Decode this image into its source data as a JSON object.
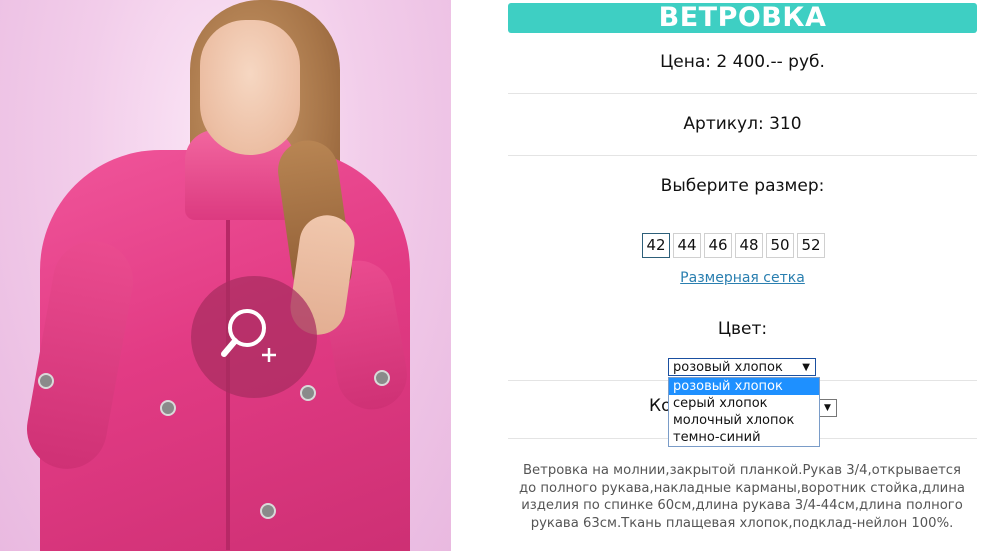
{
  "product": {
    "title": "ВЕТРОВКА",
    "price_line": "Цена: 2 400.-- руб.",
    "article_line": "Артикул: 310",
    "choose_size_label": "Выберите размер:",
    "sizes": [
      "42",
      "44",
      "46",
      "48",
      "50",
      "52"
    ],
    "selected_size": "42",
    "size_chart_link": "Размерная сетка",
    "color_label": "Цвет:",
    "color_select": {
      "value": "розовый хлопок",
      "options": [
        "розовый хлопок",
        "серый хлопок",
        "молочный хлопок",
        "темно-синий"
      ]
    },
    "quantity_label": "Ко",
    "description": "Ветровка на молнии,закрытой планкой.Рукав 3/4,открывается до полного рукава,накладные карманы,воротник стойка,длина изделия по спинке 60см,длина рукава 3/4-44см,длина полного рукава 63см.Ткань плащевая хлопок,подклад-нейлон 100%."
  },
  "colors": {
    "title_bar": "#3ecfc3",
    "link": "#2a7fb0",
    "dropdown_highlight": "#1e90ff"
  },
  "icons": {
    "zoom": "zoom-in-icon",
    "dropdown_arrow": "▼"
  }
}
